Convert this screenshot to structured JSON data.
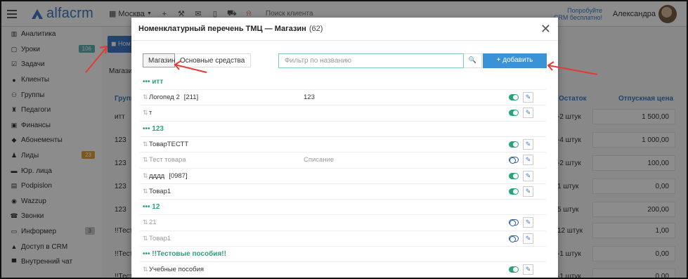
{
  "topbar": {
    "logo": "alfacrm",
    "branch": "Москва",
    "search_placeholder": "Поиск клиента",
    "promo_line1": "Попробуйте",
    "promo_line2": "CRM бесплатно!",
    "user": "Александра"
  },
  "sidebar": {
    "items": [
      {
        "label": "Аналитика",
        "icon": "chart-icon"
      },
      {
        "label": "Уроки",
        "icon": "calendar-icon",
        "badge": "106"
      },
      {
        "label": "Задачи",
        "icon": "tasks-icon"
      },
      {
        "label": "Клиенты",
        "icon": "user-icon"
      },
      {
        "label": "Группы",
        "icon": "group-icon"
      },
      {
        "label": "Педагоги",
        "icon": "teacher-icon"
      },
      {
        "label": "Финансы",
        "icon": "money-icon"
      },
      {
        "label": "Абонементы",
        "icon": "tag-icon"
      },
      {
        "label": "Лиды",
        "icon": "lead-icon",
        "badge": "23"
      },
      {
        "label": "Юр. лица",
        "icon": "briefcase-icon"
      },
      {
        "label": "Podpislon",
        "icon": "document-icon"
      },
      {
        "label": "Wazzup",
        "icon": "whatsapp-icon"
      },
      {
        "label": "Звонки",
        "icon": "phone-icon"
      },
      {
        "label": "Информер",
        "icon": "informer-icon",
        "badge": "3"
      },
      {
        "label": "Доступ в CRM",
        "icon": "lock-icon"
      },
      {
        "label": "Внутренний чат",
        "icon": "chat-icon"
      }
    ]
  },
  "background": {
    "button_label": "Ном",
    "tab_label": "Магази",
    "col_group": "Групп",
    "rows_left": [
      "итт",
      "123",
      "123",
      "123",
      "123",
      "!!Тест",
      "!!Тест",
      "!!Тест"
    ],
    "col_stock": "Остаток",
    "col_price": "Отпускная цена",
    "stock": [
      "-2 штук",
      "-4 штук",
      "-2 штук",
      "1 штук",
      "5 штук",
      "12 штук",
      "-1 штук",
      "-1 штук"
    ],
    "prices": [
      "1 500,00",
      "1 000,00",
      "100,00",
      "0,00",
      "200,00",
      "1,00",
      "0,00",
      "0,00"
    ]
  },
  "modal": {
    "title": "Номенклатурный перечень ТМЦ — Магазин",
    "count": "(62)",
    "tabs": [
      "Магазин",
      "Основные средства"
    ],
    "filter_placeholder": "Фильтр по названию",
    "add_label": "+ добавить",
    "groups": [
      {
        "name": "••• итт",
        "rows": [
          {
            "name": "Логопед 2",
            "code": "[211]",
            "note": "123",
            "active": true
          },
          {
            "name": "т",
            "code": "",
            "note": "",
            "active": true
          }
        ]
      },
      {
        "name": "••• 123",
        "rows": [
          {
            "name": "ТоварТЕСТТ",
            "code": "",
            "note": "",
            "active": true
          },
          {
            "name": "Тест товара",
            "code": "",
            "note": "Списание",
            "active": false
          },
          {
            "name": "дддд",
            "code": "[0987]",
            "note": "",
            "active": true
          },
          {
            "name": "Товар1",
            "code": "",
            "note": "",
            "active": true
          }
        ]
      },
      {
        "name": "••• 12",
        "rows": [
          {
            "name": "21",
            "code": "",
            "note": "",
            "active": false
          },
          {
            "name": "Товар1",
            "code": "",
            "note": "",
            "active": false
          }
        ]
      },
      {
        "name": "••• !!Тестовые пособия!!",
        "rows": [
          {
            "name": "Учебные пособия",
            "code": "",
            "note": "",
            "active": true
          }
        ]
      }
    ]
  },
  "colors": {
    "accent": "#3c7bc6",
    "group_green": "#2aa37b",
    "annotation_red": "#e53935"
  }
}
